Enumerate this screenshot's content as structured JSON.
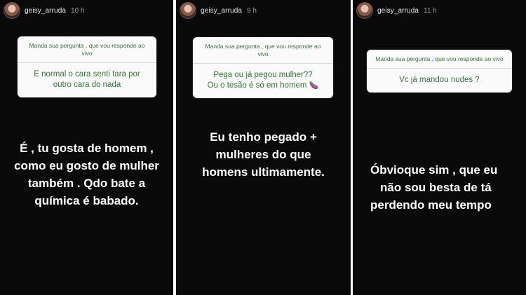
{
  "stories": [
    {
      "username": "geisy_arruda",
      "time": "10 h",
      "prompt": "Manda sua pergunta , que vou responde ao vivo",
      "question": "E normal o cara senti tara por outro cara do nada",
      "answer_lines": [
        "É , tu gosta de homem ,",
        "como eu gosto de mulher",
        "também . Qdo bate a",
        "química é babado."
      ]
    },
    {
      "username": "geisy_arruda",
      "time": "9 h",
      "prompt": "Manda sua pergunta , que vou responde ao vivo",
      "question_line1": "Pega ou já pegou mulher??",
      "question_line2": "Ou o tesão é só em homem",
      "question_emoji": "eggplant-emoji",
      "answer_lines": [
        "Eu tenho pegado +",
        "mulheres do que",
        "homens ultimamente."
      ]
    },
    {
      "username": "geisy_arruda",
      "time": "11 h",
      "prompt": "Manda sua pergunta , que vou responde ao vivo",
      "question": "Vc já mandou nudes ?",
      "answer_lines": [
        "Óbvioque sim , que eu",
        "não sou besta de tá",
        "perdendo meu tempo"
      ]
    }
  ],
  "colors": {
    "background": "#0a0a0a",
    "card": "#fafafa",
    "card_text": "#2d7a31",
    "answer_text": "#ffffff"
  }
}
